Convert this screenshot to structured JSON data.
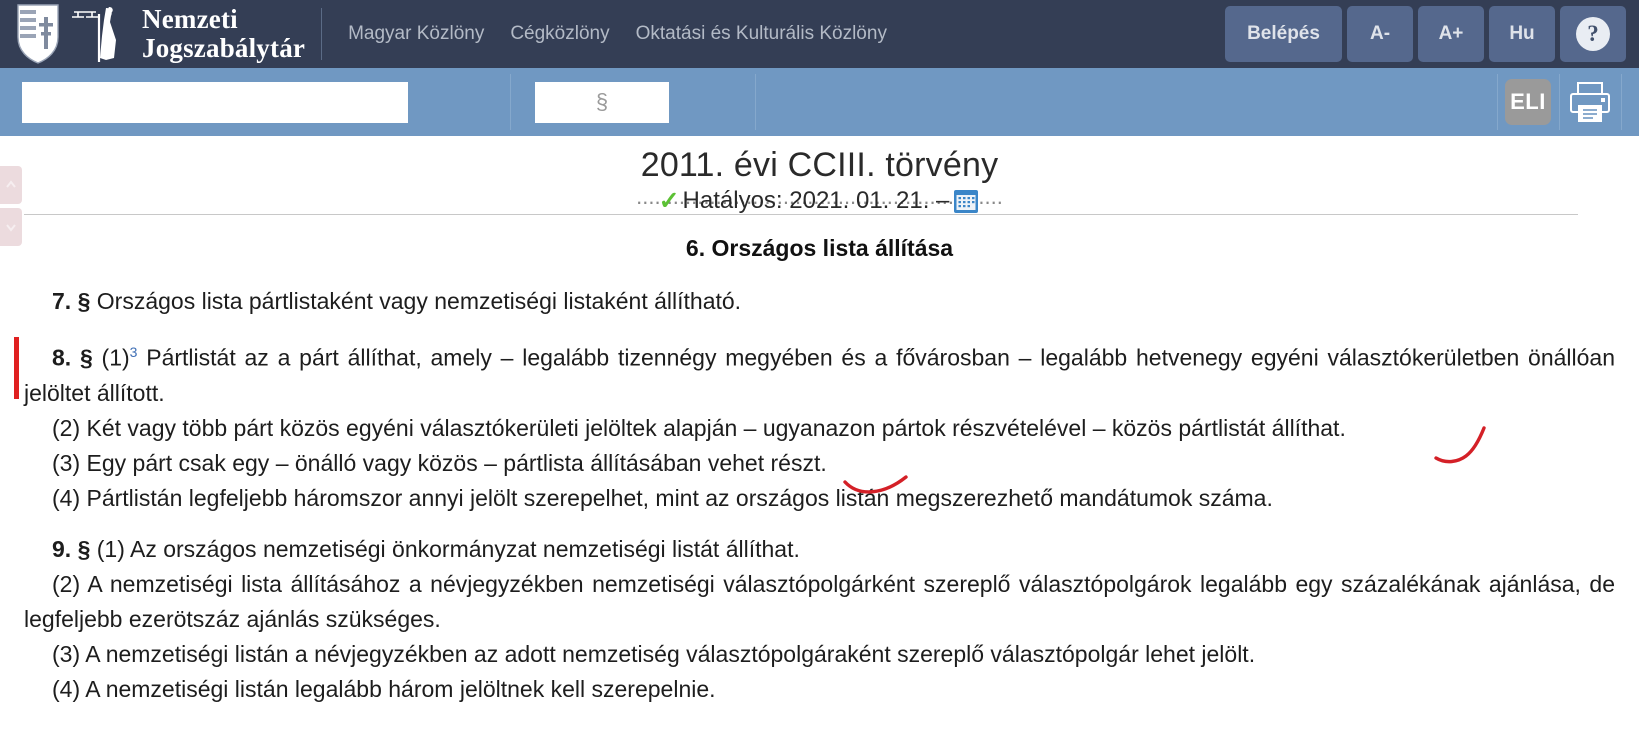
{
  "header": {
    "brand": {
      "line1": "Nemzeti",
      "line2": "Jogszabálytár",
      "crest_icon": "hungarian-coat-of-arms-icon",
      "justitia_icon": "justitia-statue-icon"
    },
    "nav": [
      {
        "label": "Magyar Közlöny"
      },
      {
        "label": "Cégközlöny"
      },
      {
        "label": "Oktatási és Kulturális Közlöny"
      }
    ],
    "actions": {
      "login": "Belépés",
      "font_decrease": "A-",
      "font_increase": "A+",
      "language": "Hu",
      "help": "?"
    },
    "colors": {
      "header_bg": "#343e55",
      "button_bg": "#55688d",
      "toolbar_bg": "#7098c2"
    }
  },
  "toolbar": {
    "search": {
      "value": "",
      "placeholder": ""
    },
    "paragraph": {
      "value": "",
      "placeholder": "§"
    },
    "eli_label": "ELI",
    "print_icon": "printer-icon"
  },
  "sidenav": {
    "up_icon": "chevron-up-icon",
    "down_icon": "chevron-down-icon"
  },
  "document": {
    "title": "2011. évi CCIII. törvény",
    "status_check_icon": "green-check-icon",
    "status": "Hatályos: 2021. 01. 21. –",
    "calendar_icon": "calendar-icon",
    "clipped_line": "............................................................",
    "section_heading": "6. Országos lista állítása",
    "paragraphs": [
      {
        "sign": "7. §",
        "text": " Országos lista pártlistaként vagy nemzetiségi listaként állítható."
      },
      {
        "sign": "8. §",
        "num": " (1)",
        "footnote": "3",
        "text": " Pártlistát az a párt állíthat, amely – legalább tizennégy megyében és a fővárosban – legalább hetvenegy egyéni választókerületben önállóan jelöltet állított."
      },
      {
        "text": "(2) Két vagy több párt közös egyéni választókerületi jelöltek alapján – ugyanazon pártok részvételével – közös pártlistát állíthat."
      },
      {
        "text": "(3) Egy párt csak egy – önálló vagy közös – pártlista állításában vehet részt."
      },
      {
        "text": "(4) Pártlistán legfeljebb háromszor annyi jelölt szerepelhet, mint az országos listán megszerezhető mandátumok száma."
      },
      {
        "sign": "9. §",
        "num": " (1)",
        "text": " Az országos nemzetiségi önkormányzat nemzetiségi listát állíthat."
      },
      {
        "text": "(2) A nemzetiségi lista állításához a névjegyzékben nemzetiségi választópolgárként szereplő választópolgárok legalább egy százalékának ajánlása, de legfeljebb ezerötszáz ajánlás szükséges."
      },
      {
        "text": "(3) A nemzetiségi listán a névjegyzékben az adott nemzetiség választópolgáraként szereplő választópolgár lehet jelölt."
      },
      {
        "text": "(4) A nemzetiségi listán legalább három jelöltnek kell szerepelnie."
      }
    ],
    "annotations": [
      {
        "name": "red-hook-mark",
        "color": "#d42027"
      },
      {
        "name": "red-curve-mark",
        "color": "#d42027"
      }
    ],
    "change_bar_color": "#e02020"
  }
}
